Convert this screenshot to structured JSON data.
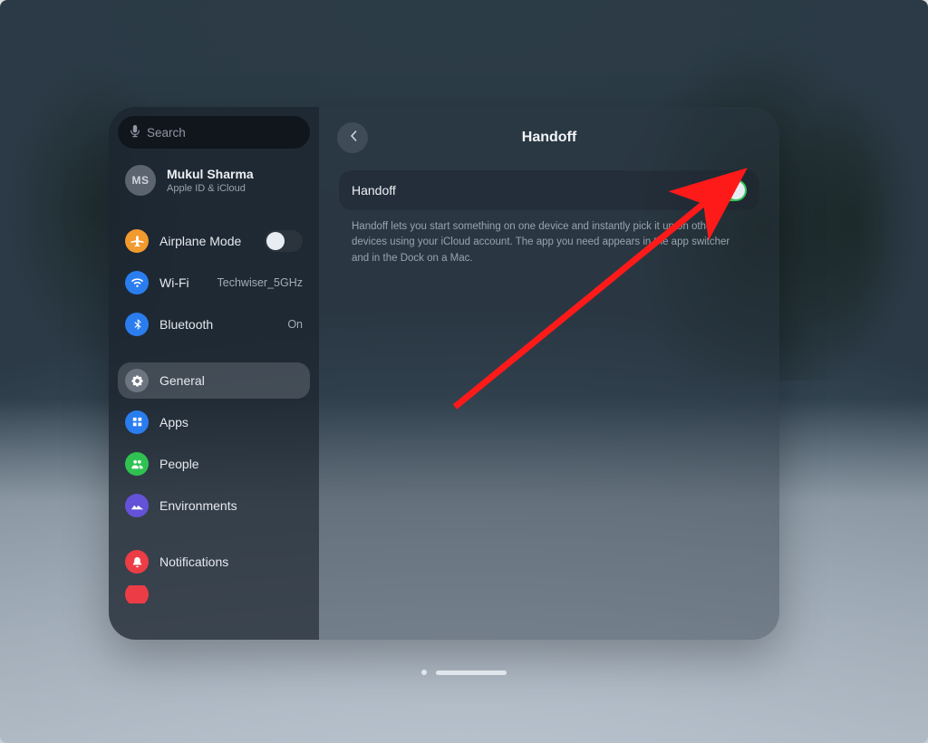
{
  "search": {
    "placeholder": "Search"
  },
  "account": {
    "initials": "MS",
    "name": "Mukul Sharma",
    "sub": "Apple ID & iCloud"
  },
  "sidebar": {
    "airplane_label": "Airplane Mode",
    "airplane_on": false,
    "wifi_label": "Wi-Fi",
    "wifi_value": "Techwiser_5GHz",
    "bluetooth_label": "Bluetooth",
    "bluetooth_value": "On",
    "general_label": "General",
    "apps_label": "Apps",
    "people_label": "People",
    "environments_label": "Environments",
    "notifications_label": "Notifications"
  },
  "content": {
    "title": "Handoff",
    "row_label": "Handoff",
    "handoff_on": true,
    "description": "Handoff lets you start something on one device and instantly pick it up on other devices using your iCloud account. The app you need appears in the app switcher and in the Dock on a Mac."
  },
  "colors": {
    "accent_green": "#34c759",
    "annotation_red": "#ff1a1a"
  }
}
